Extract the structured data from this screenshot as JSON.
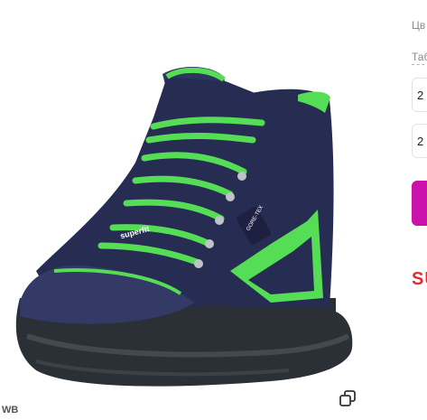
{
  "gallery": {
    "image_alt": "Superfit kids winter boots navy with green laces",
    "boot_logo": "superfit",
    "gore_tex_label": "GORE-TEX",
    "watermark": "WB",
    "copy_icon": "copy-icon"
  },
  "panel": {
    "color_label": "Цв",
    "size_table_label": "Таб",
    "sizes": [
      "2",
      "2"
    ],
    "cart_button_color": "#cb11ab",
    "brand_text": "SU"
  },
  "colors": {
    "boot_navy": "#262c52",
    "lace_green": "#55dd55",
    "accent_magenta": "#cb11ab",
    "brand_red": "#e52b2b"
  }
}
